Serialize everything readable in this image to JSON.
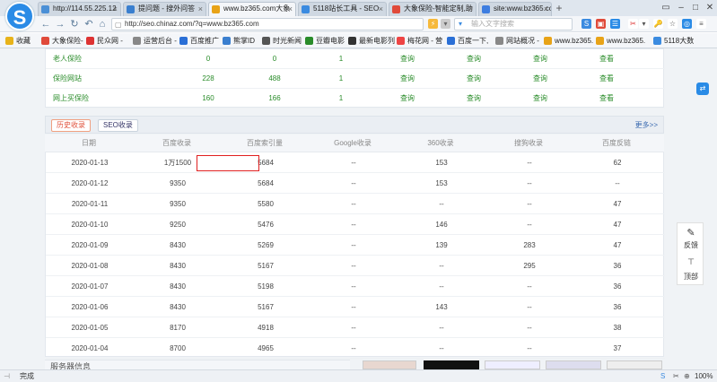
{
  "tabs": [
    {
      "label": "http://114.55.225.12",
      "color": "#4a8fd6"
    },
    {
      "label": "提问题 - 搜外问答",
      "color": "#3a7fcf"
    },
    {
      "label": "www.bz365.com大象",
      "color": "#e8a317"
    },
    {
      "label": "5118站长工具 - SEO",
      "color": "#3b8be0"
    },
    {
      "label": "大象保险-智能定制,助",
      "color": "#e04a3a"
    },
    {
      "label": "site:www.bz365.com",
      "color": "#3d7de0"
    }
  ],
  "nav": {
    "address": "http://seo.chinaz.com/?q=www.bz365.com",
    "search_placeholder": "输入文字搜索"
  },
  "bookmarks": [
    {
      "label": "收藏",
      "color": "#e8b31a"
    },
    {
      "label": "大象保险-",
      "color": "#e04a3a"
    },
    {
      "label": "民众网 -",
      "color": "#d33"
    },
    {
      "label": "运营后台 -",
      "color": "#888"
    },
    {
      "label": "百度推广",
      "color": "#2a6fd6"
    },
    {
      "label": "熊掌ID",
      "color": "#3a7fcf"
    },
    {
      "label": "时光新闻",
      "color": "#555"
    },
    {
      "label": "豆瓣电影",
      "color": "#2a8c2a"
    },
    {
      "label": "最新电影列",
      "color": "#333"
    },
    {
      "label": "梅花网 - 营",
      "color": "#e44"
    },
    {
      "label": "百度一下,",
      "color": "#2a6fd6"
    },
    {
      "label": "网站概况 -",
      "color": "#888"
    },
    {
      "label": "www.bz365.",
      "color": "#e8a317"
    },
    {
      "label": "www.bz365.",
      "color": "#e8a317"
    },
    {
      "label": "5118大数",
      "color": "#3b8be0"
    }
  ],
  "top_rows": [
    {
      "name": "老人保险",
      "c1": "0",
      "c2": "0",
      "c3": "1",
      "c4": "查询",
      "c5": "查询",
      "c6": "查询",
      "c7": "查看"
    },
    {
      "name": "保险网站",
      "c1": "228",
      "c2": "488",
      "c3": "1",
      "c4": "查询",
      "c5": "查询",
      "c6": "查询",
      "c7": "查看"
    },
    {
      "name": "网上买保险",
      "c1": "160",
      "c2": "166",
      "c3": "1",
      "c4": "查询",
      "c5": "查询",
      "c6": "查询",
      "c7": "查看"
    }
  ],
  "section_tabs": {
    "history": "历史收录",
    "seo": "SEO收录",
    "more": "更多>>"
  },
  "headers": [
    "日期",
    "百度收录",
    "百度索引量",
    "Google收录",
    "360收录",
    "搜狗收录",
    "百度反链"
  ],
  "rows": [
    [
      "2020-01-13",
      "1万1500",
      "5684",
      "--",
      "153",
      "--",
      "62"
    ],
    [
      "2020-01-12",
      "9350",
      "5684",
      "--",
      "153",
      "--",
      "--"
    ],
    [
      "2020-01-11",
      "9350",
      "5580",
      "--",
      "--",
      "--",
      "47"
    ],
    [
      "2020-01-10",
      "9250",
      "5476",
      "--",
      "146",
      "--",
      "47"
    ],
    [
      "2020-01-09",
      "8430",
      "5269",
      "--",
      "139",
      "283",
      "47"
    ],
    [
      "2020-01-08",
      "8430",
      "5167",
      "--",
      "--",
      "295",
      "36"
    ],
    [
      "2020-01-07",
      "8430",
      "5198",
      "--",
      "--",
      "--",
      "36"
    ],
    [
      "2020-01-06",
      "8430",
      "5167",
      "--",
      "143",
      "--",
      "36"
    ],
    [
      "2020-01-05",
      "8170",
      "4918",
      "--",
      "--",
      "--",
      "38"
    ],
    [
      "2020-01-04",
      "8700",
      "4965",
      "--",
      "--",
      "--",
      "37"
    ]
  ],
  "side": {
    "feedback": "反馈",
    "top": "顶部"
  },
  "bottom_title": "服务器信息",
  "status": {
    "done": "完成",
    "zoom": "100%"
  }
}
